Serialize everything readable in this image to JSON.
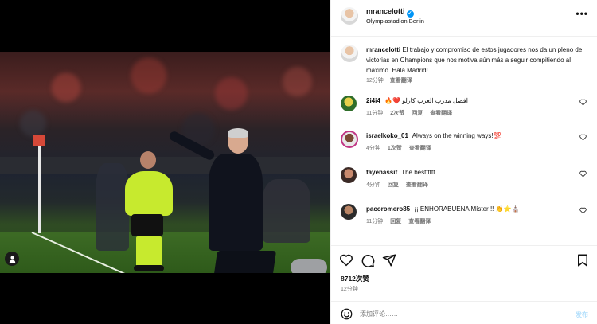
{
  "post": {
    "username": "mrancelotti",
    "location": "Olympiastadion Berlin",
    "caption": "El trabajo y compromiso de estos jugadores nos da un pleno de victorias en Champions que nos motiva aún más a seguir compitiendo al máximo. Hala Madrid!",
    "caption_time": "12分钟",
    "see_translation": "查看翻译",
    "likes": "8712次赞",
    "post_time": "12分钟"
  },
  "comments": [
    {
      "user": "2i4i4",
      "text": "🔥❤️ افضل مدرب العرب كارلو",
      "time": "11分钟",
      "likes": "2次赞",
      "reply": "回复",
      "translate": "查看翻译"
    },
    {
      "user": "israelkoko_01",
      "text": "Always on the winning ways!💯",
      "time": "4分钟",
      "likes": "1次赞",
      "reply": "",
      "translate": "查看翻译"
    },
    {
      "user": "fayenassif",
      "text": "The bestttttt",
      "time": "4分钟",
      "likes": "",
      "reply": "回复",
      "translate": "查看翻译"
    },
    {
      "user": "pacoromero85",
      "text": "¡¡ ENHORABUENA Míster !! 👏⭐⛪",
      "time": "11分钟",
      "likes": "",
      "reply": "回复",
      "translate": "查看翻译"
    }
  ],
  "composer": {
    "placeholder": "添加评论……",
    "post_label": "发布"
  },
  "icons": {
    "more": "more-icon",
    "heart": "heart-icon",
    "comment": "comment-icon",
    "share": "share-icon",
    "save": "bookmark-icon",
    "emoji": "emoji-icon",
    "tag": "user-tag-icon"
  },
  "colors": {
    "verified": "#0095f6",
    "muted": "#737373",
    "post_disabled": "#b2dffc"
  }
}
